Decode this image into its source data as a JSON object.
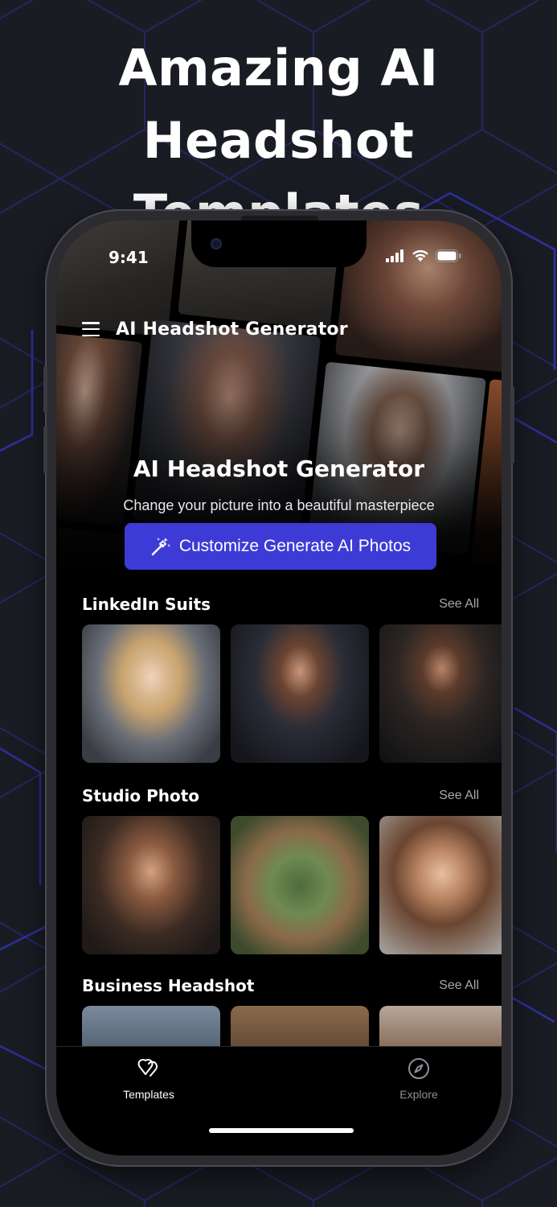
{
  "promo": {
    "title_line1": "Amazing AI",
    "title_line2": "Headshot Templates"
  },
  "status_bar": {
    "time": "9:41",
    "icons": [
      "signal-icon",
      "wifi-icon",
      "battery-icon"
    ]
  },
  "app_bar": {
    "menu_icon": "hamburger-menu-icon",
    "title": "AI Headshot Generator"
  },
  "hero": {
    "heading": "AI Headshot Generator",
    "subtitle": "Change your picture into a beautiful masterpiece",
    "cta_label": "Customize Generate AI Photos",
    "cta_icon": "magic-wand-icon"
  },
  "sections": [
    {
      "title": "LinkedIn Suits",
      "see_all": "See All"
    },
    {
      "title": "Studio Photo",
      "see_all": "See All"
    },
    {
      "title": "Business Headshot",
      "see_all": "See All"
    }
  ],
  "tabs": [
    {
      "label": "Templates",
      "icon": "templates-icon",
      "active": true
    },
    {
      "label": "Explore",
      "icon": "compass-icon",
      "active": false
    }
  ],
  "colors": {
    "accent": "#3d3bd6",
    "background": "#1a1c24",
    "hex_lines": "#2b2f9e",
    "tab_active": "#ffffff",
    "tab_inactive": "#8e8e96"
  }
}
